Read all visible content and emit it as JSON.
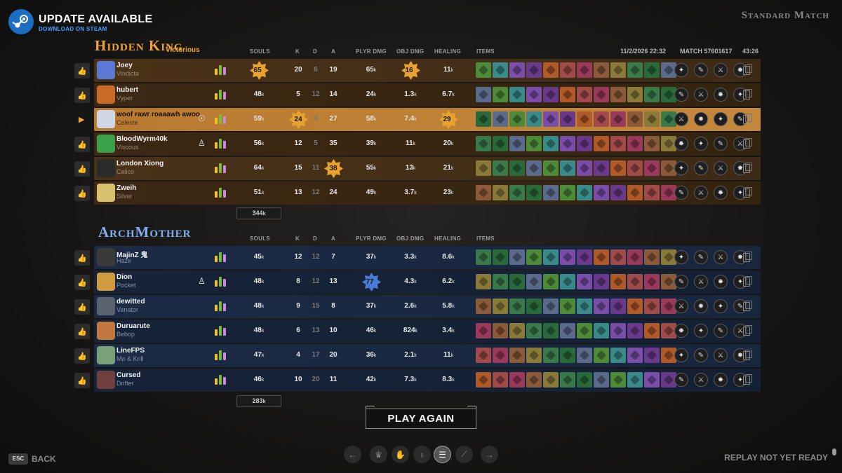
{
  "banner": {
    "title": "UPDATE AVAILABLE",
    "subtitle": "DOWNLOAD ON STEAM"
  },
  "match_type": "Standard Match",
  "date": "11/2/2026 22:32",
  "match_id": "MATCH 57601617",
  "duration": "43:26",
  "headers": {
    "souls": "SOULS",
    "k": "K",
    "d": "D",
    "a": "A",
    "plyr_dmg": "PLYR DMG",
    "obj_dmg": "OBJ DMG",
    "healing": "HEALING",
    "items": "ITEMS"
  },
  "team1": {
    "name": "Hidden King",
    "result": "Victorious",
    "total_souls": "344",
    "players": [
      {
        "name": "Joey",
        "hero": "Vindicta",
        "souls": "65",
        "k": "20",
        "d": "6",
        "a": "19",
        "plyr": "65",
        "obj": "16",
        "heal": "11"
      },
      {
        "name": "hubert",
        "hero": "Vyper",
        "souls": "48",
        "k": "5",
        "d": "12",
        "a": "14",
        "plyr": "24",
        "obj": "1.3",
        "heal": "6.7"
      },
      {
        "name": "woof rawr roaaawh awoo",
        "hero": "Celeste",
        "souls": "59",
        "k": "24",
        "d": "4",
        "a": "27",
        "plyr": "58",
        "obj": "7.4",
        "heal": "29"
      },
      {
        "name": "BloodWyrm40k",
        "hero": "Viscous",
        "souls": "56",
        "k": "12",
        "d": "5",
        "a": "35",
        "plyr": "39",
        "obj": "11",
        "heal": "20"
      },
      {
        "name": "London Xiong",
        "hero": "Calico",
        "souls": "64",
        "k": "15",
        "d": "11",
        "a": "38",
        "plyr": "55",
        "obj": "13",
        "heal": "21"
      },
      {
        "name": "Zweih",
        "hero": "Silver",
        "souls": "51",
        "k": "13",
        "d": "12",
        "a": "24",
        "plyr": "49",
        "obj": "3.7",
        "heal": "23"
      }
    ]
  },
  "team2": {
    "name": "ArchMother",
    "total_souls": "283",
    "players": [
      {
        "name": "MajinZ 鬼",
        "hero": "Haze",
        "souls": "45",
        "k": "12",
        "d": "12",
        "a": "7",
        "plyr": "37",
        "obj": "3.3",
        "heal": "8.6"
      },
      {
        "name": "Dion",
        "hero": "Pocket",
        "souls": "48",
        "k": "8",
        "d": "12",
        "a": "13",
        "plyr": "77",
        "obj": "4.3",
        "heal": "6.2"
      },
      {
        "name": "dewitted",
        "hero": "Venator",
        "souls": "48",
        "k": "9",
        "d": "15",
        "a": "8",
        "plyr": "37",
        "obj": "2.6",
        "heal": "5.8"
      },
      {
        "name": "Duruarute",
        "hero": "Bebop",
        "souls": "48",
        "k": "6",
        "d": "13",
        "a": "10",
        "plyr": "46",
        "obj": "824",
        "heal": "3.4"
      },
      {
        "name": "LineFPS",
        "hero": "Mo & Krill",
        "souls": "47",
        "k": "4",
        "d": "17",
        "a": "20",
        "plyr": "36",
        "obj": "2.1",
        "heal": "11"
      },
      {
        "name": "Cursed",
        "hero": "Drifter",
        "souls": "46",
        "k": "10",
        "d": "20",
        "a": "11",
        "plyr": "42",
        "obj": "7.3",
        "heal": "8.3"
      }
    ]
  },
  "k_suffix": "k",
  "play_again": "PLAY AGAIN",
  "esc_key": "ESC",
  "back": "BACK",
  "replay_status": "REPLAY NOT YET READY",
  "colors": {
    "orange": "#f2a33a",
    "blue": "#7db1f2",
    "steam": "#1b6ec2"
  }
}
